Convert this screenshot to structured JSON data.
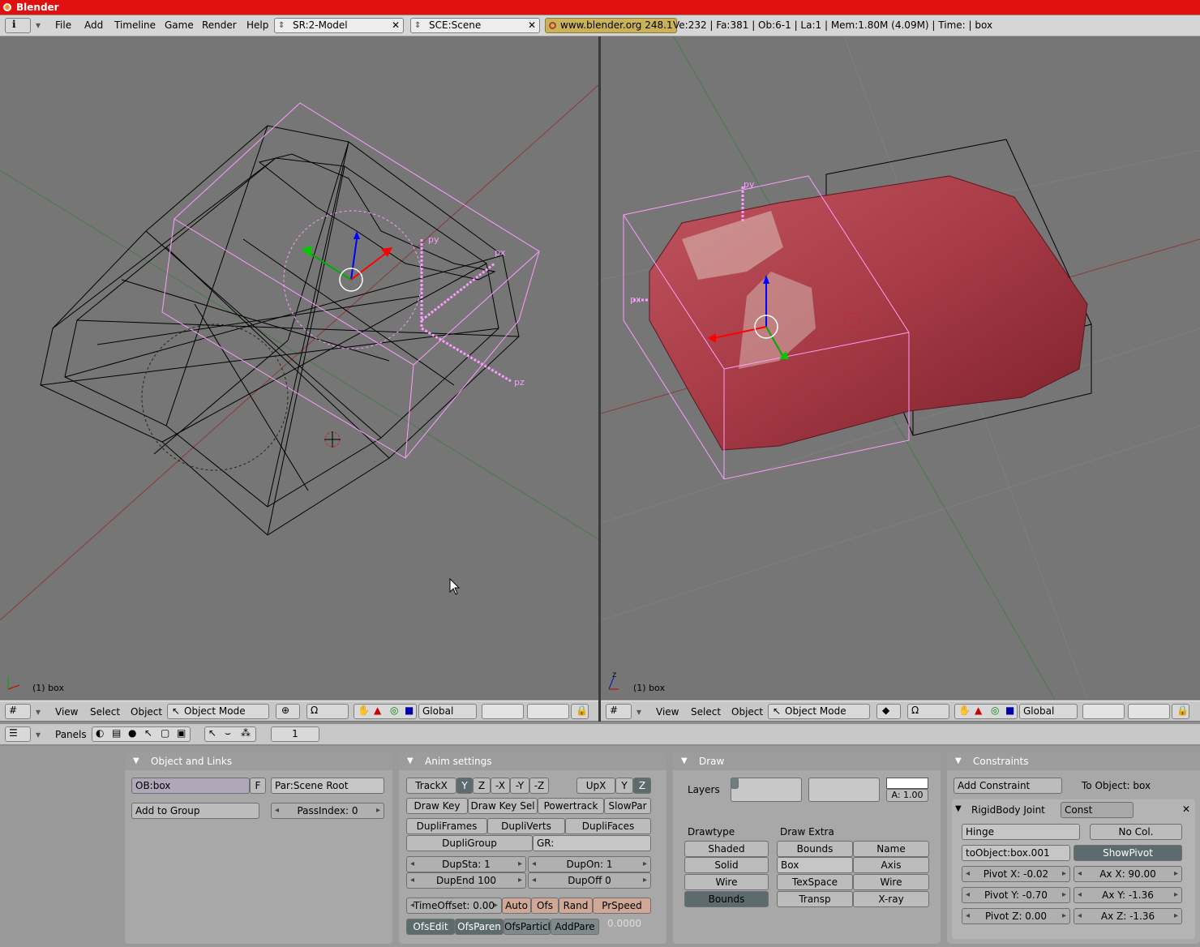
{
  "title": "Blender",
  "menu": [
    "File",
    "Add",
    "Timeline",
    "Game",
    "Render",
    "Help"
  ],
  "screen": "SR:2-Model",
  "scene": "SCE:Scene",
  "url": "www.blender.org 248.1",
  "stats": "Ve:232 | Fa:381 | Ob:6-1 | La:1  | Mem:1.80M (4.09M)  | Time: | box",
  "viewport_left": {
    "label": "(1) box",
    "axis_labels": [
      "py",
      "px",
      "pz"
    ]
  },
  "viewport_right": {
    "label": "(1) box",
    "axis_labels": [
      "py",
      "px"
    ]
  },
  "view_header": {
    "view": "View",
    "select": "Select",
    "object": "Object",
    "mode": "Object Mode",
    "orientation": "Global"
  },
  "buttons_header": {
    "panels": "Panels",
    "frame": "1"
  },
  "object_links": {
    "title": "Object and Links",
    "ob_name": "OB:box",
    "f": "F",
    "parent": "Par:Scene Root",
    "add_group": "Add to Group",
    "pass_index": "PassIndex: 0"
  },
  "anim": {
    "title": "Anim settings",
    "track": [
      "TrackX",
      "Y",
      "Z",
      "-X",
      "-Y",
      "-Z"
    ],
    "up": [
      "UpX",
      "Y",
      "Z"
    ],
    "row2": [
      "Draw Key",
      "Draw Key Sel",
      "Powertrack",
      "SlowPar"
    ],
    "dupli": [
      "DupliFrames",
      "DupliVerts",
      "DupliFaces"
    ],
    "dupligroup": "DupliGroup",
    "gr": "GR:",
    "dupsta": "DupSta: 1",
    "dupon": "DupOn: 1",
    "dupend": "DupEnd 100",
    "dupoff": "DupOff 0",
    "timeoffset": "TimeOffset: 0.00",
    "time_btns": [
      "Auto",
      "Ofs",
      "Rand",
      "PrSpeed"
    ],
    "ofs_btns": [
      "OfsEdit",
      "OfsParen",
      "OfsParticl",
      "AddPare"
    ],
    "value": "0.0000"
  },
  "draw": {
    "title": "Draw",
    "layers": "Layers",
    "alpha": "A: 1.00",
    "drawtype_label": "Drawtype",
    "drawtype": [
      "Shaded",
      "Solid",
      "Wire",
      "Bounds"
    ],
    "drawextra_label": "Draw Extra",
    "extra_left": [
      "Bounds",
      "Box",
      "TexSpace",
      "Transp"
    ],
    "extra_right": [
      "Name",
      "Axis",
      "Wire",
      "X-ray"
    ]
  },
  "constraints": {
    "title": "Constraints",
    "add": "Add Constraint",
    "to_object": "To Object: box",
    "item_name": "RigidBody Joint",
    "item_type": "Const",
    "joint_type": "Hinge",
    "nocol": "No Col.",
    "to_obj_field": "toObject:box.001",
    "showpivot": "ShowPivot",
    "pivots": [
      "Pivot X: -0.02",
      "Pivot Y: -0.70",
      "Pivot Z: 0.00"
    ],
    "axes": [
      "Ax X: 90.00",
      "Ax Y: -1.36",
      "Ax Z: -1.36"
    ]
  },
  "colors": {
    "titlebar": "#e01010",
    "viewport": "#767676",
    "selected": "#ff9bff",
    "mesh": "#b84550"
  }
}
